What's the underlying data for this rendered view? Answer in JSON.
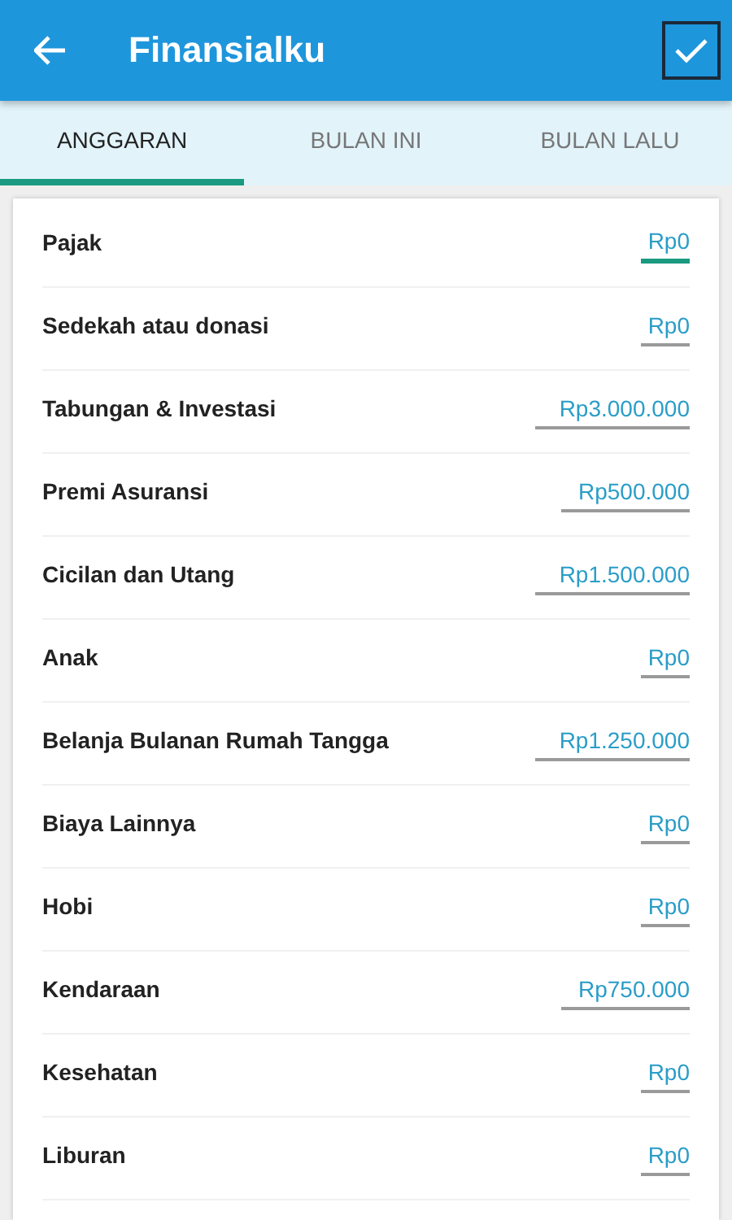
{
  "app_bar": {
    "title": "Finansialku",
    "confirm_focused": true
  },
  "tabs": [
    {
      "label": "ANGGARAN",
      "selected": true
    },
    {
      "label": "BULAN INI",
      "selected": false
    },
    {
      "label": "BULAN LALU",
      "selected": false
    }
  ],
  "budget_items": [
    {
      "label": "Pajak",
      "value": "Rp0",
      "focused": true
    },
    {
      "label": "Sedekah atau donasi",
      "value": "Rp0",
      "focused": false
    },
    {
      "label": "Tabungan & Investasi",
      "value": "Rp3.000.000",
      "focused": false
    },
    {
      "label": "Premi Asuransi",
      "value": "Rp500.000",
      "focused": false
    },
    {
      "label": "Cicilan dan Utang",
      "value": "Rp1.500.000",
      "focused": false
    },
    {
      "label": "Anak",
      "value": "Rp0",
      "focused": false
    },
    {
      "label": "Belanja Bulanan Rumah Tangga",
      "value": "Rp1.250.000",
      "focused": false
    },
    {
      "label": "Biaya Lainnya",
      "value": "Rp0",
      "focused": false
    },
    {
      "label": "Hobi",
      "value": "Rp0",
      "focused": false
    },
    {
      "label": "Kendaraan",
      "value": "Rp750.000",
      "focused": false
    },
    {
      "label": "Kesehatan",
      "value": "Rp0",
      "focused": false
    },
    {
      "label": "Liburan",
      "value": "Rp0",
      "focused": false
    }
  ]
}
